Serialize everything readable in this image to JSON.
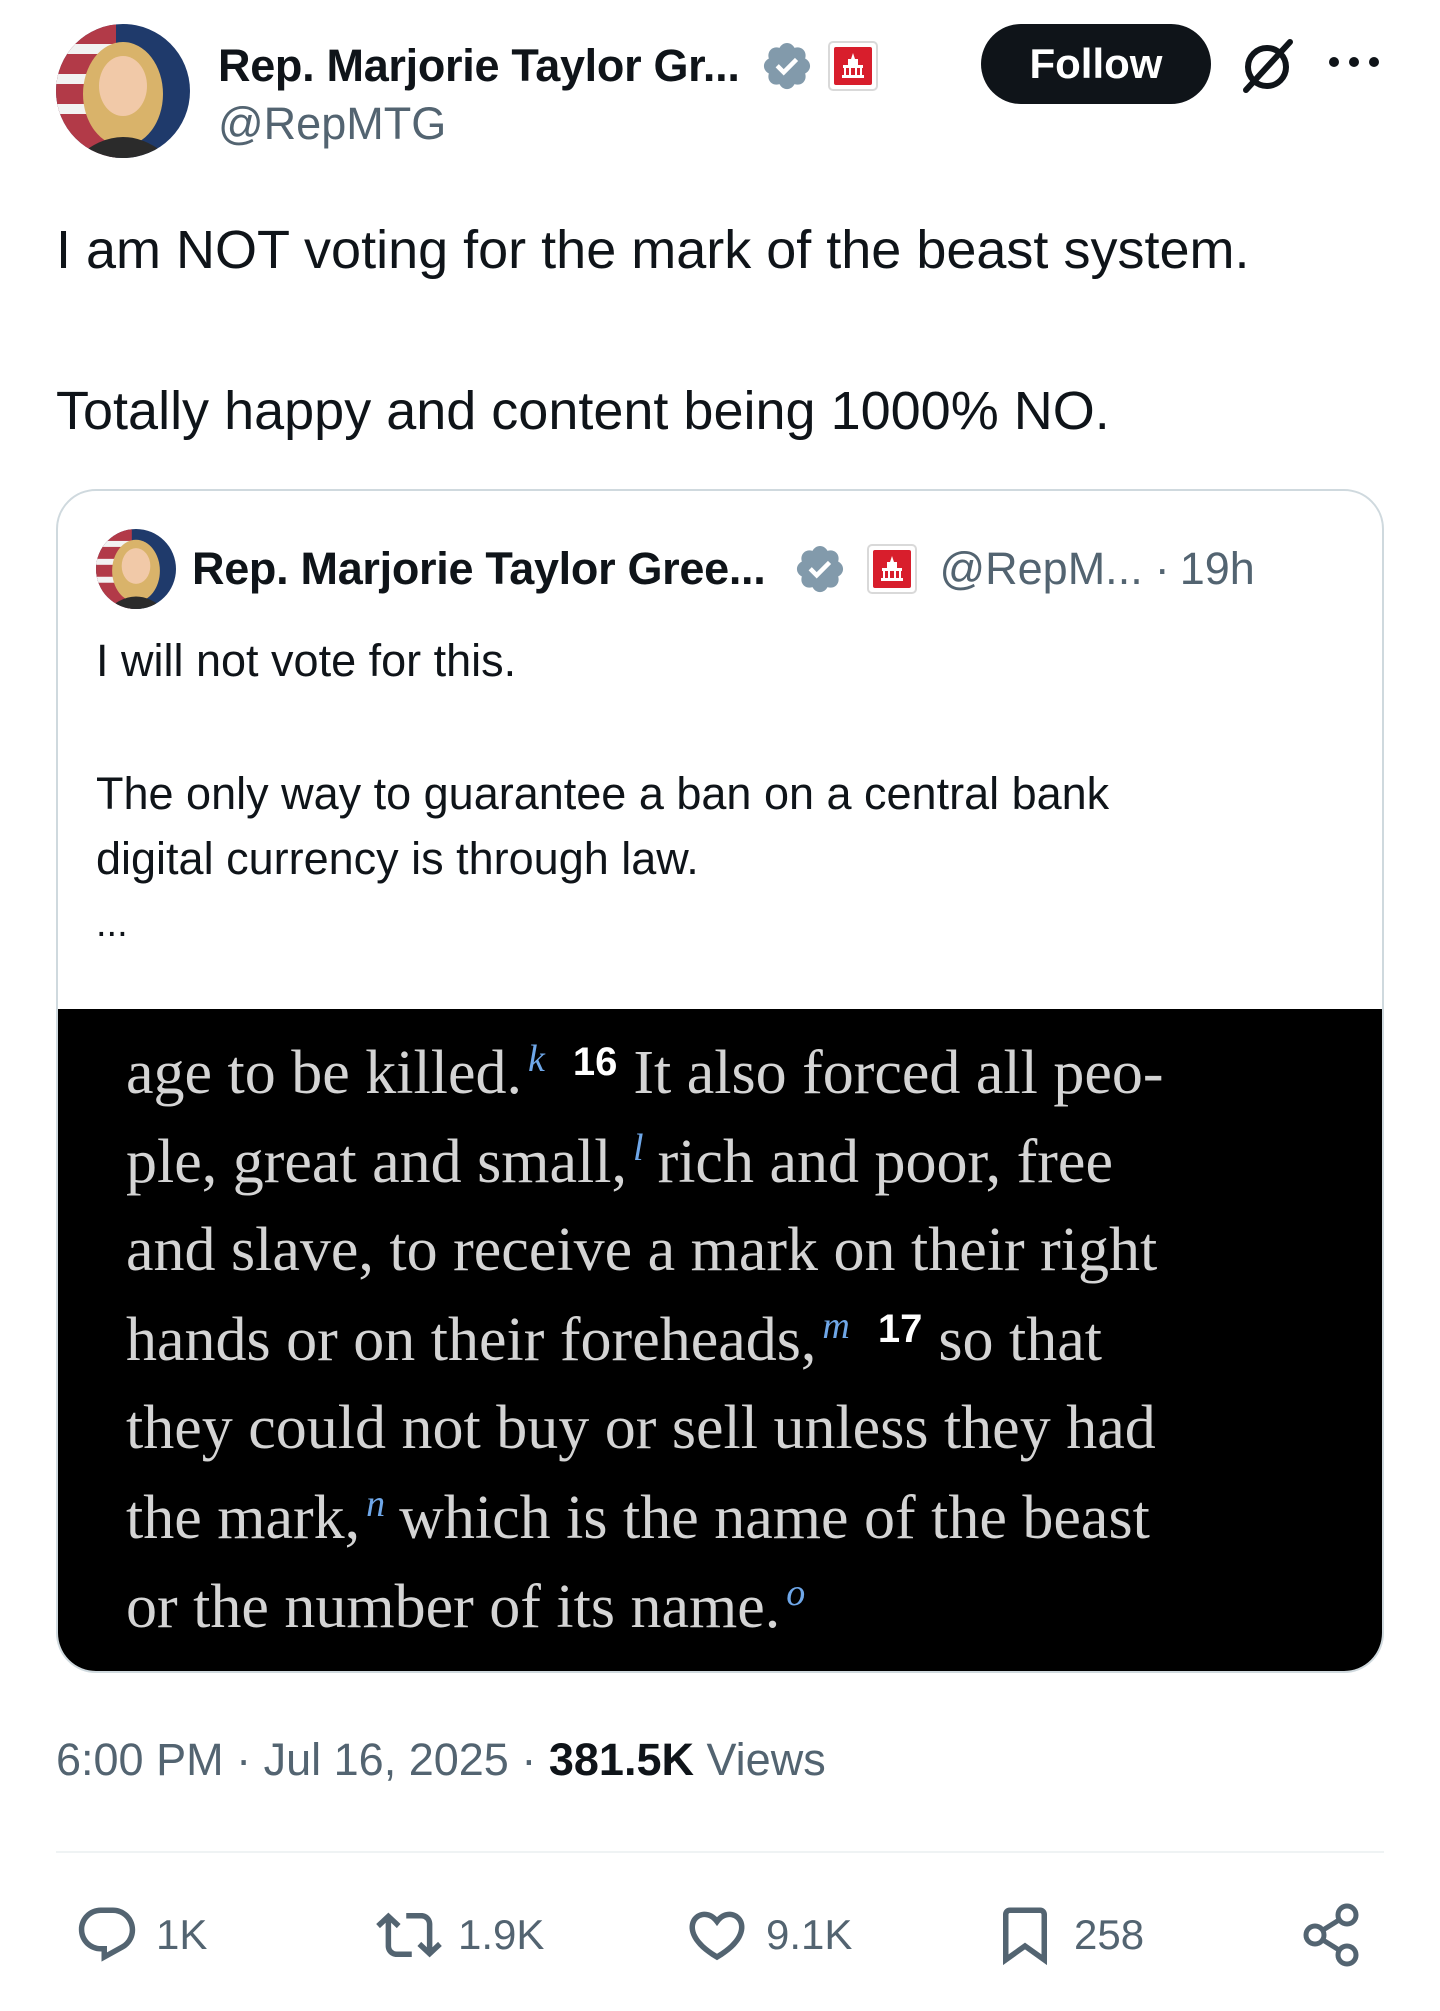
{
  "author": {
    "display_name": "Rep. Marjorie Taylor Gr...",
    "handle": "@RepMTG",
    "follow_label": "Follow"
  },
  "tweet": {
    "line1": "I am NOT voting for the mark of the beast system.",
    "line2": "Totally happy and content being 1000% NO."
  },
  "quoted": {
    "display_name": "Rep. Marjorie Taylor Gree...",
    "handle": "@RepM...",
    "separator": "·",
    "time": "19h",
    "line1": "I will not vote for this.",
    "line2": "The only way to guarantee a ban on a central bank",
    "line3": "digital currency is through law.",
    "ellipsis": "...",
    "image_text": {
      "l1a": "age to be killed.",
      "l1k": "k",
      "l1n": "16",
      "l1b": "It also forced all peo-",
      "l2a": "ple, great and small,",
      "l2l": "l",
      "l2b": "rich and poor, free",
      "l3": "and slave, to receive a mark on their right",
      "l4a": "hands or on their foreheads,",
      "l4m": "m",
      "l4n": "17",
      "l4b": "so that",
      "l5": "they could not buy or sell unless they had",
      "l6a": "the mark,",
      "l6n": "n",
      "l6b": "which is the name of the beast",
      "l7a": "or the number of its name.",
      "l7o": "o"
    }
  },
  "meta": {
    "time": "6:00 PM",
    "sep1": "·",
    "date": "Jul 16, 2025",
    "sep2": "·",
    "views_count": "381.5K",
    "views_label": "Views"
  },
  "actions": {
    "replies": "1K",
    "reposts": "1.9K",
    "likes": "9.1K",
    "bookmarks": "258"
  },
  "icons": [
    "verified-badge-icon",
    "government-badge-icon",
    "grok-icon",
    "more-icon",
    "reply-icon",
    "repost-icon",
    "like-icon",
    "bookmark-icon",
    "share-icon"
  ],
  "colors": {
    "text_primary": "#0f1419",
    "text_secondary": "#536471",
    "verified_badge": "#829aab",
    "government_badge": "#d81e2c",
    "border": "#cfd9de",
    "footnote_blue": "#6fa7e8"
  }
}
